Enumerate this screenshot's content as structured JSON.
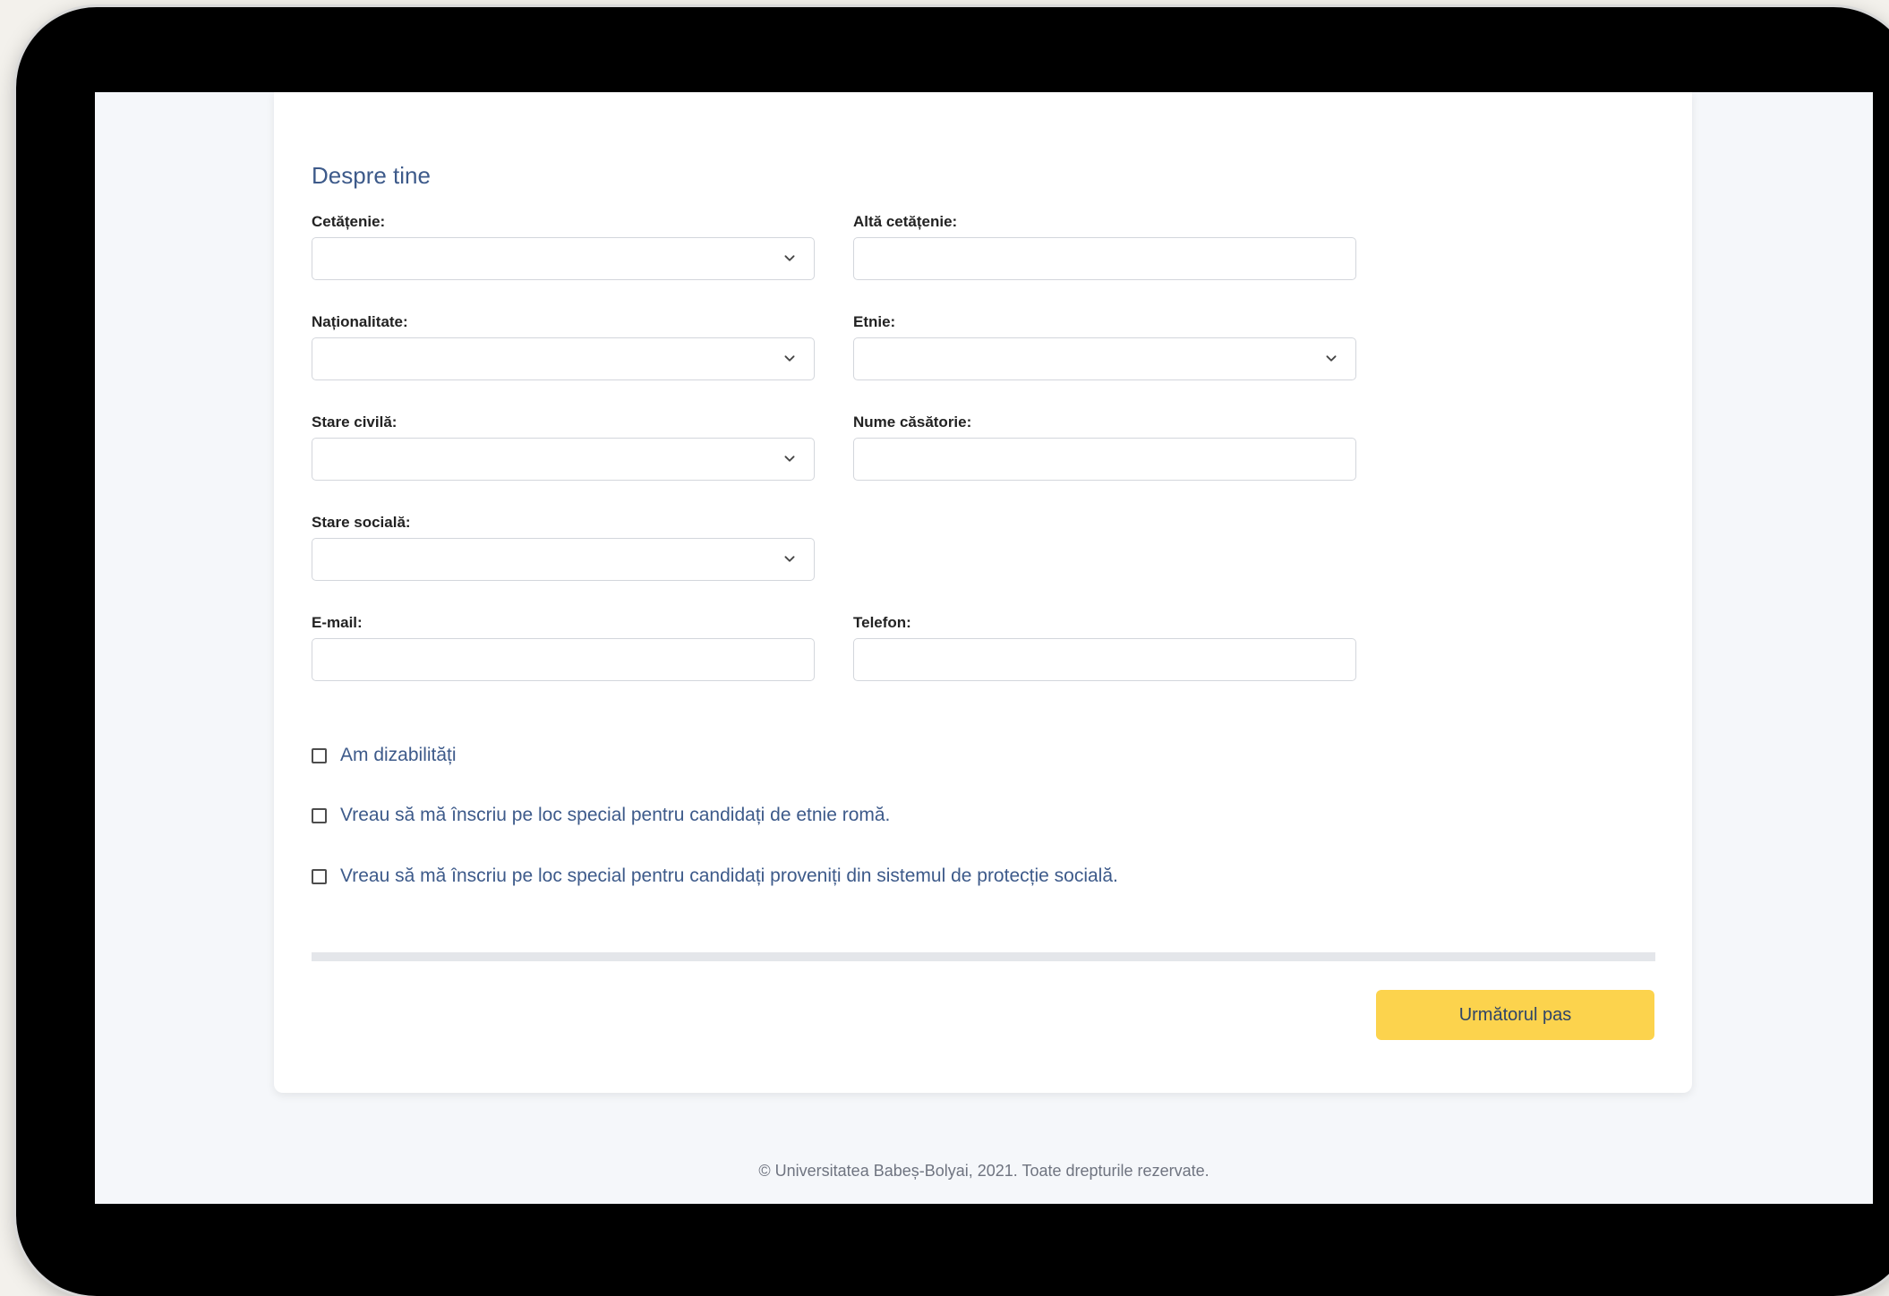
{
  "section_title": "Despre tine",
  "fields": {
    "cetatenie": {
      "label": "Cetățenie:",
      "type": "select",
      "value": ""
    },
    "alta_cetatenie": {
      "label": "Altă cetățenie:",
      "type": "text",
      "value": ""
    },
    "nationalitate": {
      "label": "Naționalitate:",
      "type": "select",
      "value": ""
    },
    "etnie": {
      "label": "Etnie:",
      "type": "select",
      "value": ""
    },
    "stare_civila": {
      "label": "Stare civilă:",
      "type": "select",
      "value": ""
    },
    "nume_casatorie": {
      "label": "Nume căsătorie:",
      "type": "text",
      "value": ""
    },
    "stare_sociala": {
      "label": "Stare socială:",
      "type": "select",
      "value": ""
    },
    "email": {
      "label": "E-mail:",
      "type": "text",
      "value": ""
    },
    "telefon": {
      "label": "Telefon:",
      "type": "text",
      "value": ""
    }
  },
  "checkboxes": [
    {
      "label": "Am dizabilități",
      "checked": false
    },
    {
      "label": "Vreau să mă înscriu pe loc special pentru candidați de etnie romă.",
      "checked": false
    },
    {
      "label": "Vreau să mă înscriu pe loc special pentru candidați proveniți din sistemul de protecție socială.",
      "checked": false
    }
  ],
  "next_button": "Următorul pas",
  "footer": "© Universitatea Babeș-Bolyai, 2021. Toate drepturile rezervate.",
  "icons": {
    "select_arrow": "chevron-down-icon"
  },
  "colors": {
    "accent_button": "#fcd34d",
    "heading_text": "#3d5a8a",
    "page_background": "#f5f7fa",
    "device_frame": "#000000"
  }
}
